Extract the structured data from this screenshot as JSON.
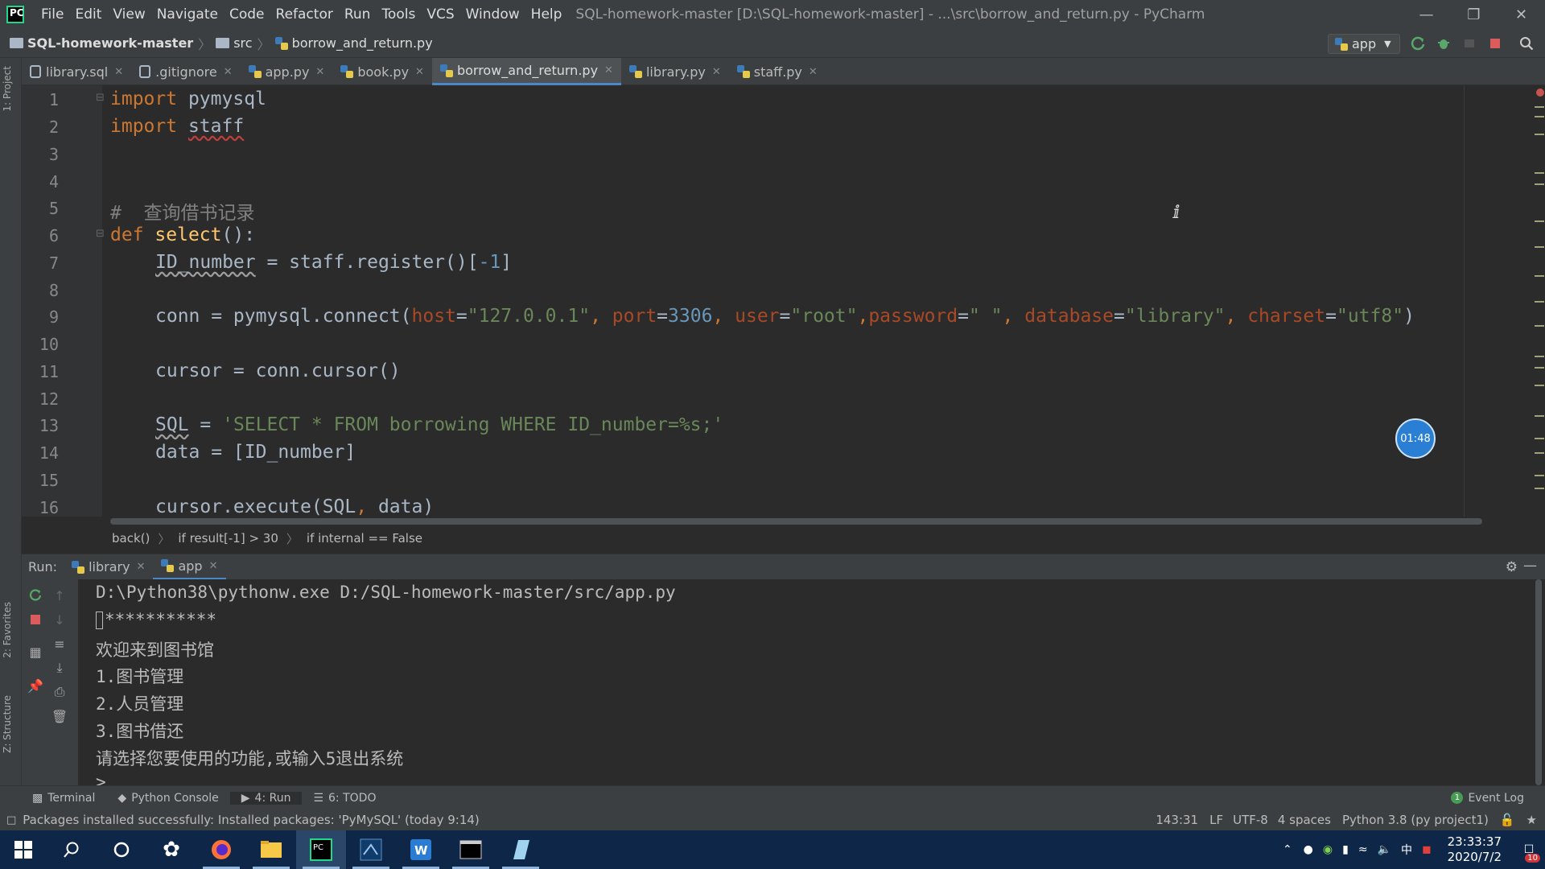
{
  "titlebar": {
    "menu": [
      "File",
      "Edit",
      "View",
      "Navigate",
      "Code",
      "Refactor",
      "Run",
      "Tools",
      "VCS",
      "Window",
      "Help"
    ],
    "title": "SQL-homework-master [D:\\SQL-homework-master] - ...\\src\\borrow_and_return.py - PyCharm"
  },
  "navbar": {
    "project": "SQL-homework-master",
    "folder": "src",
    "file": "borrow_and_return.py",
    "run_config": "app"
  },
  "left_strip": {
    "project": "1: Project",
    "favorites": "2: Favorites",
    "structure": "Z: Structure"
  },
  "tabs": [
    {
      "label": "library.sql"
    },
    {
      "label": ".gitignore"
    },
    {
      "label": "app.py"
    },
    {
      "label": "book.py"
    },
    {
      "label": "borrow_and_return.py",
      "active": true
    },
    {
      "label": "library.py"
    },
    {
      "label": "staff.py"
    }
  ],
  "editor": {
    "line_numbers": [
      "1",
      "2",
      "3",
      "4",
      "5",
      "6",
      "7",
      "8",
      "9",
      "10",
      "11",
      "12",
      "13",
      "14",
      "15",
      "16"
    ],
    "lines": {
      "l1_kw": "import",
      "l1_mod": "pymysql",
      "l2_kw": "import",
      "l2_mod": "staff",
      "l5_comment": "#  查询借书记录",
      "l6_kw": "def",
      "l6_fn": "select",
      "l6_rest": "():",
      "l7_var": "ID_number",
      "l7_mid": " = staff.register()[",
      "l7_num": "-1",
      "l7_end": "]",
      "l9_a": "conn = pymysql.connect(",
      "l9_host_k": "host",
      "l9_host_v": "\"127.0.0.1\"",
      "l9_port_k": "port",
      "l9_port_v": "3306",
      "l9_user_k": "user",
      "l9_user_v": "\"root\"",
      "l9_pw_k": "password",
      "l9_pw_v": "\" \"",
      "l9_db_k": "database",
      "l9_db_v": "\"library\"",
      "l9_cs_k": "charset",
      "l9_cs_v": "\"utf8\"",
      "l11": "cursor = conn.cursor()",
      "l13_var": "SQL",
      "l13_eq": " = ",
      "l13_str": "'SELECT * FROM borrowing WHERE ID_number=%s;'",
      "l14": "data = [ID_number]",
      "l16_a": "cursor.execute(SQL",
      "l16_b": ", ",
      "l16_c": "data)"
    }
  },
  "code_breadcrumb": [
    "back()",
    "if result[-1] > 30",
    "if internal == False"
  ],
  "timer": "01:48",
  "run": {
    "label": "Run:",
    "tabs": [
      {
        "label": "library"
      },
      {
        "label": "app",
        "active": true
      }
    ],
    "console": [
      "D:\\Python38\\pythonw.exe D:/SQL-homework-master/src/app.py",
      "***********",
      "欢迎来到图书馆",
      "1.图书管理",
      "2.人员管理",
      "3.图书借还",
      "请选择您要使用的功能,或输入5退出系统",
      ">"
    ]
  },
  "bottom_tools": {
    "terminal": "Terminal",
    "console": "Python Console",
    "run": "4: Run",
    "todo": "6: TODO",
    "event_log": "Event Log",
    "event_count": "1"
  },
  "status": {
    "message": "Packages installed successfully: Installed packages: 'PyMySQL' (today 9:14)",
    "position": "143:31",
    "line_sep": "LF",
    "encoding": "UTF-8",
    "indent": "4 spaces",
    "interpreter": "Python 3.8 (py project1)"
  },
  "taskbar": {
    "time": "23:33:37",
    "date": "2020/7/2",
    "ime": "中",
    "notifications": "10"
  }
}
